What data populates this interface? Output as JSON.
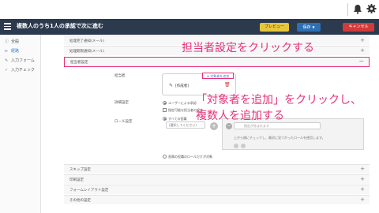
{
  "app": {
    "title": "複数人のうち1人の承認で次に進む",
    "buttons": {
      "preview": "プレビュー",
      "save": "保存",
      "cancel": "キャンセル"
    }
  },
  "sidebar": {
    "items": [
      {
        "label": "全般",
        "icon": "info-icon",
        "active": false
      },
      {
        "label": "経路",
        "icon": "route-icon",
        "active": true
      },
      {
        "label": "入力フォーム",
        "icon": "pencil-icon",
        "active": false
      },
      {
        "label": "入力チェック",
        "icon": "check-icon",
        "active": false
      }
    ]
  },
  "panels": {
    "top": [
      "処理完了通知(メール)",
      "処理期限通知(メール)"
    ],
    "open": "担当者設定",
    "bottom": [
      "スキップ設定",
      "印刷設定",
      "フォームレイアウト設定",
      "その他の設定"
    ]
  },
  "assignee": {
    "label": "担当者",
    "add_target_link": "対象者を追加",
    "item_name": "[作成者]"
  },
  "detail": {
    "label": "詳細設定",
    "opt1": "ユーザーによる承認",
    "opt2": "指定可能な担当者の設定"
  },
  "role": {
    "label": "ロール設定",
    "radio_all": "すべての役職",
    "select_placeholder": "(選択してください)",
    "chip_placeholder": "指定が含まれます",
    "note": "上から順にチェックし、最初に見つかったロールを使用します。",
    "radio_direct": "直属の役職のロールだけが対象"
  },
  "annotations": {
    "callout1": "担当者設定をクリックする",
    "callout2_line1": "「対象者を追加」をクリックし、",
    "callout2_line2": "複数人を追加する"
  },
  "colors": {
    "accent": "#e6317a",
    "appbar": "#2b3a4d",
    "preview": "#e7c63d",
    "save": "#2e6fb4",
    "cancel": "#d33a3a",
    "link": "#3a7bd5"
  }
}
